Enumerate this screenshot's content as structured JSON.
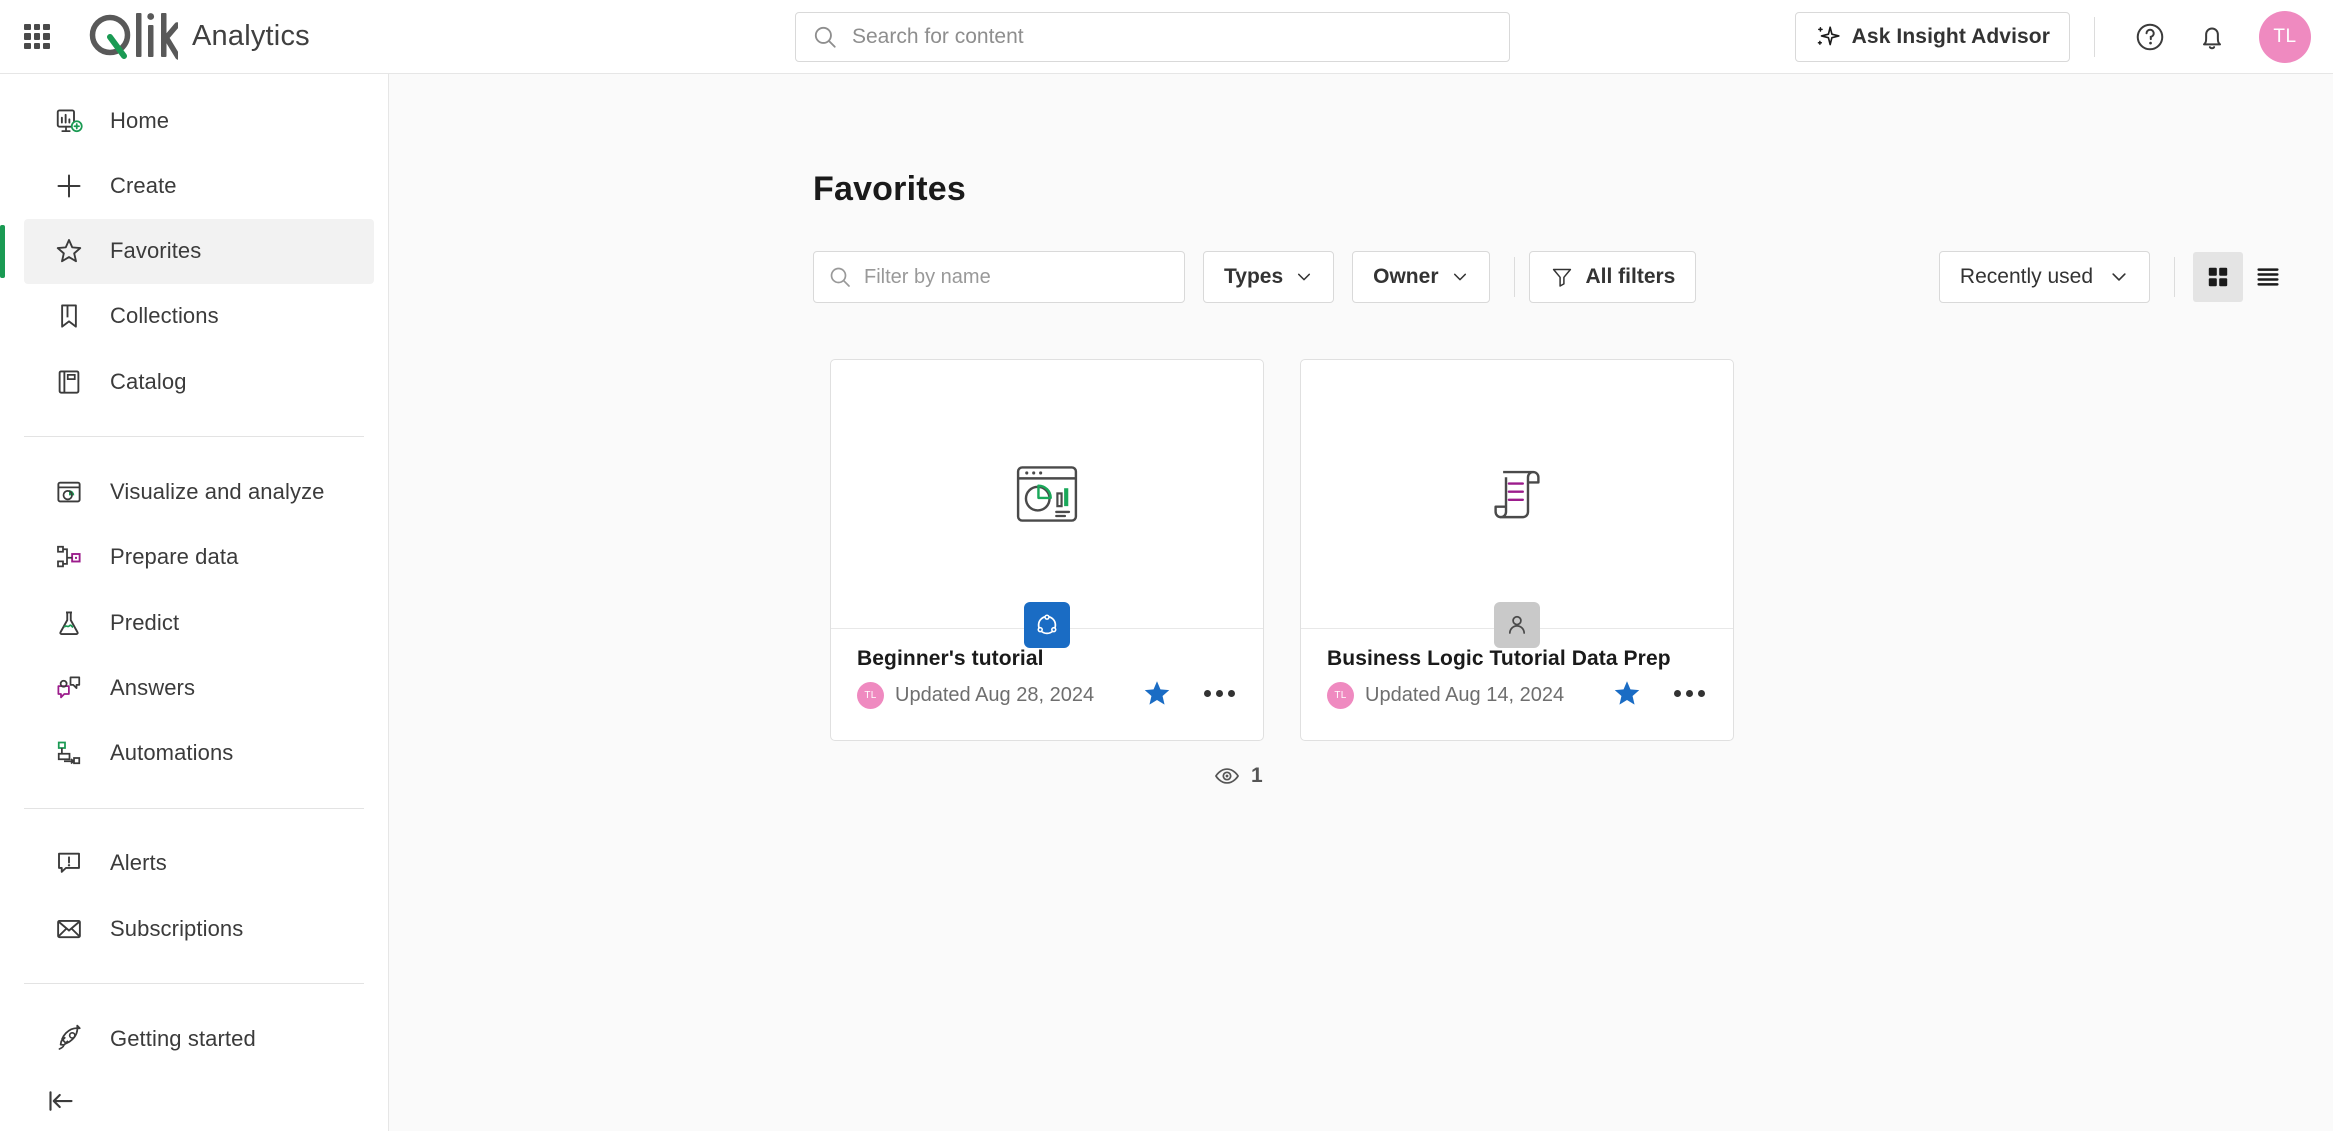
{
  "header": {
    "app_launcher_icon": "waffle-grid-icon",
    "brand": "Qlik",
    "product": "Analytics",
    "search": {
      "placeholder": "Search for content",
      "icon": "search-icon"
    },
    "ask_insight_advisor": {
      "label": "Ask Insight Advisor",
      "icon": "sparkle-icon"
    },
    "help_icon": "help-circle-icon",
    "notifications_icon": "bell-icon",
    "avatar": {
      "initials": "TL",
      "color": "#ef8ac0"
    }
  },
  "sidebar": {
    "items": [
      {
        "label": "Home",
        "icon": "home-dashboard-icon",
        "active": false
      },
      {
        "label": "Create",
        "icon": "plus-icon",
        "active": false
      },
      {
        "label": "Favorites",
        "icon": "star-outline-icon",
        "active": true
      },
      {
        "label": "Collections",
        "icon": "bookmark-icon",
        "active": false
      },
      {
        "label": "Catalog",
        "icon": "catalog-book-icon",
        "active": false
      },
      {
        "label": "Visualize and analyze",
        "icon": "visualize-icon",
        "active": false
      },
      {
        "label": "Prepare data",
        "icon": "prepare-data-icon",
        "active": false
      },
      {
        "label": "Predict",
        "icon": "flask-icon",
        "active": false
      },
      {
        "label": "Answers",
        "icon": "answers-chat-icon",
        "active": false
      },
      {
        "label": "Automations",
        "icon": "automations-icon",
        "active": false
      },
      {
        "label": "Alerts",
        "icon": "alert-icon",
        "active": false
      },
      {
        "label": "Subscriptions",
        "icon": "envelope-icon",
        "active": false
      },
      {
        "label": "Getting started",
        "icon": "rocket-icon",
        "active": false
      }
    ],
    "collapse_icon": "collapse-left-icon",
    "active_accent_color": "#1a9a53"
  },
  "main": {
    "page_title": "Favorites",
    "toolbar": {
      "filter_placeholder": "Filter by name",
      "filter_icon": "search-icon",
      "types_label": "Types",
      "owner_label": "Owner",
      "all_filters_label": "All filters",
      "all_filters_icon": "funnel-icon",
      "sort_label": "Recently used",
      "grid_view_icon": "grid-view-icon",
      "list_view_icon": "list-view-icon",
      "active_view": "grid"
    },
    "cards": [
      {
        "title": "Beginner's tutorial",
        "date": "Updated Aug 28, 2024",
        "owner_initials": "TL",
        "thumb_icon": "app-chart-window-icon",
        "badge_icon": "qlik-sense-app-icon",
        "badge_color": "#1a6cc4",
        "favorited": true,
        "star_color": "#1a6cc4",
        "more_icon": "more-dots-icon"
      },
      {
        "title": "Business Logic Tutorial Data Prep",
        "date": "Updated Aug 14, 2024",
        "owner_initials": "TL",
        "thumb_icon": "script-scroll-icon",
        "badge_icon": "person-icon",
        "badge_color": "#c9c9c9",
        "favorited": true,
        "star_color": "#1a6cc4",
        "more_icon": "more-dots-icon"
      }
    ],
    "views": {
      "icon": "eye-icon",
      "count": "1"
    }
  }
}
